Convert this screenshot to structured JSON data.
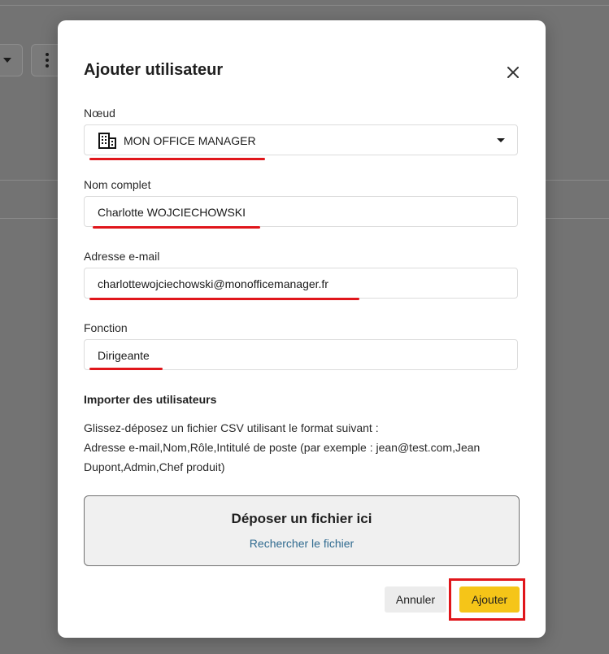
{
  "dialog": {
    "title": "Ajouter utilisateur",
    "close_icon": "close-icon"
  },
  "form": {
    "node": {
      "label": "Nœud",
      "value": "MON OFFICE MANAGER",
      "icon": "building-icon"
    },
    "full_name": {
      "label": "Nom complet",
      "value": "Charlotte WOJCIECHOWSKI"
    },
    "email": {
      "label": "Adresse e-mail",
      "value": "charlottewojciechowski@monofficemanager.fr"
    },
    "role": {
      "label": "Fonction",
      "value": "Dirigeante"
    }
  },
  "import": {
    "heading": "Importer des utilisateurs",
    "description_line1": "Glissez-déposez un fichier CSV utilisant le format suivant :",
    "description_line2": "Adresse e-mail,Nom,Rôle,Intitulé de poste (par exemple : jean@test.com,Jean",
    "description_line3": "Dupont,Admin,Chef produit)",
    "dropzone_title": "Déposer un fichier ici",
    "dropzone_link": "Rechercher le fichier"
  },
  "actions": {
    "cancel_label": "Annuler",
    "add_label": "Ajouter"
  },
  "colors": {
    "accent": "#f5c518",
    "annotation": "#e0161b",
    "link": "#2f6a8f"
  }
}
